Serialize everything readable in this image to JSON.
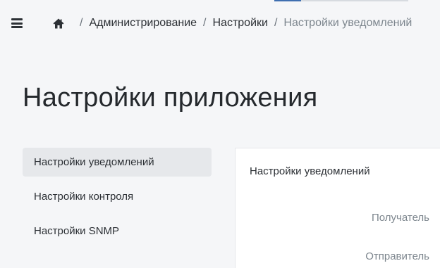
{
  "header": {
    "breadcrumb": {
      "home_icon": "home-icon",
      "separator": "/",
      "items": [
        {
          "label": "Администрирование"
        },
        {
          "label": "Настройки"
        },
        {
          "label": "Настройки уведомлений"
        }
      ]
    },
    "menu_icon": "hamburger-menu-icon"
  },
  "page": {
    "title": "Настройки приложения"
  },
  "sidebar": {
    "items": [
      {
        "label": "Настройки уведомлений",
        "active": true
      },
      {
        "label": "Настройки контроля",
        "active": false
      },
      {
        "label": "Настройки SNMP",
        "active": false
      }
    ]
  },
  "panel": {
    "title": "Настройки уведомлений",
    "fields": [
      {
        "label": "Получатель"
      },
      {
        "label": "Отправитель"
      }
    ]
  },
  "colors": {
    "background": "#f5f6f8",
    "panel": "#ffffff",
    "active_nav": "#e6e8eb",
    "accent": "#3f6fb0",
    "muted_text": "#7d868e"
  }
}
